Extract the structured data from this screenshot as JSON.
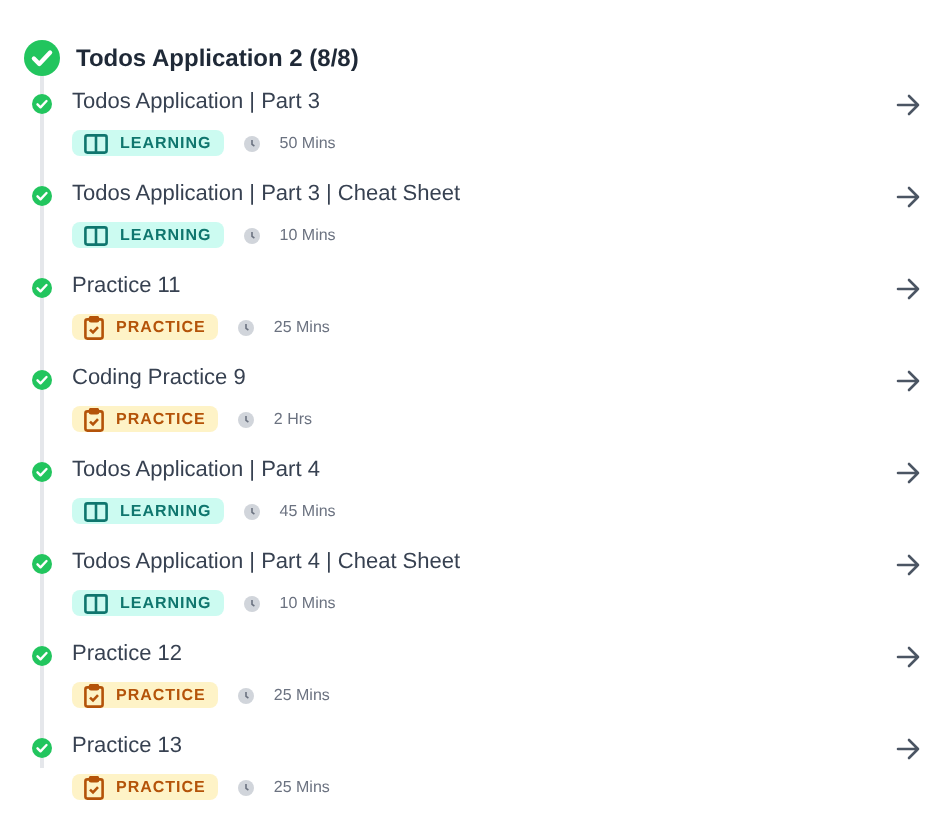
{
  "header": {
    "title": "Todos Application 2 (8/8)",
    "completed": true
  },
  "items": [
    {
      "title": "Todos Application | Part 3",
      "kind": "learning",
      "tag": "LEARNING",
      "duration": "50 Mins",
      "completed": true
    },
    {
      "title": "Todos Application | Part 3 | Cheat Sheet",
      "kind": "learning",
      "tag": "LEARNING",
      "duration": "10 Mins",
      "completed": true
    },
    {
      "title": "Practice 11",
      "kind": "practice",
      "tag": "PRACTICE",
      "duration": "25 Mins",
      "completed": true
    },
    {
      "title": "Coding Practice 9",
      "kind": "practice",
      "tag": "PRACTICE",
      "duration": "2 Hrs",
      "completed": true
    },
    {
      "title": "Todos Application | Part 4",
      "kind": "learning",
      "tag": "LEARNING",
      "duration": "45 Mins",
      "completed": true
    },
    {
      "title": "Todos Application | Part 4 | Cheat Sheet",
      "kind": "learning",
      "tag": "LEARNING",
      "duration": "10 Mins",
      "completed": true
    },
    {
      "title": "Practice 12",
      "kind": "practice",
      "tag": "PRACTICE",
      "duration": "25 Mins",
      "completed": true
    },
    {
      "title": "Practice 13",
      "kind": "practice",
      "tag": "PRACTICE",
      "duration": "25 Mins",
      "completed": true
    }
  ]
}
